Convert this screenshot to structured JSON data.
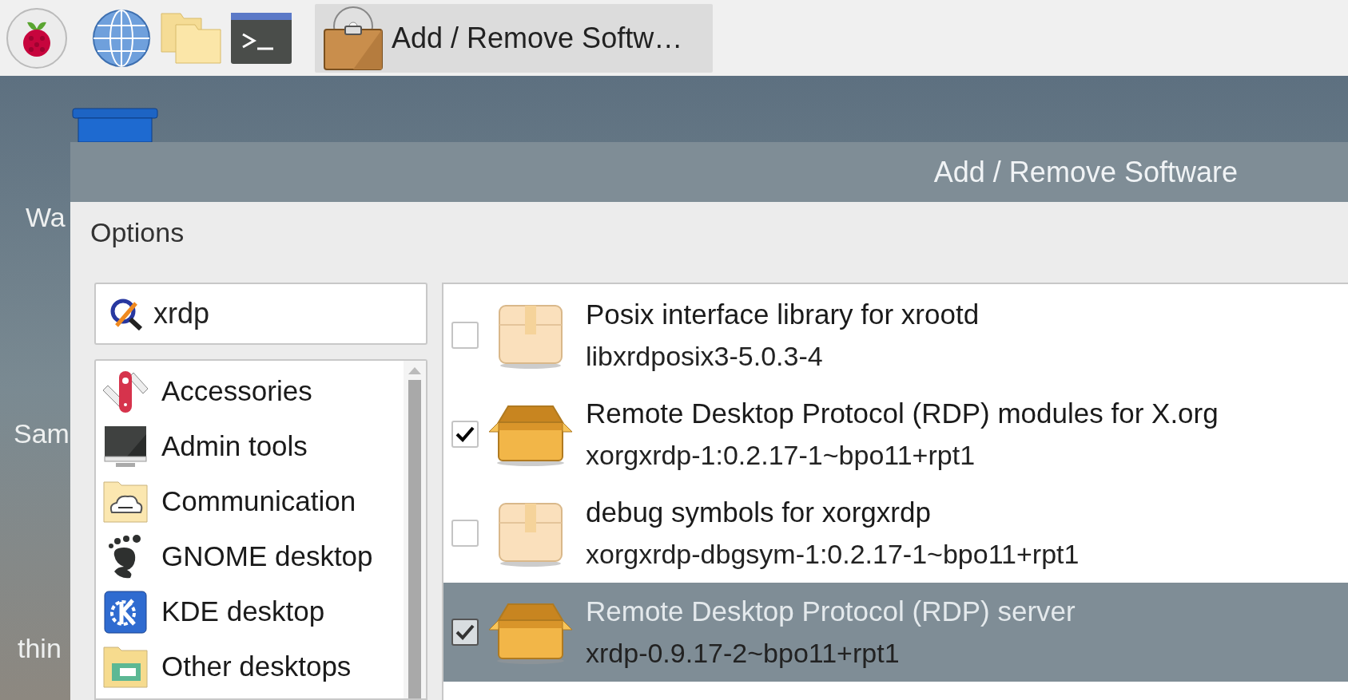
{
  "taskbar": {
    "task": {
      "label": "Add / Remove Softw…",
      "selected": true
    }
  },
  "desktop_icons": [
    {
      "label": "Wa"
    },
    {
      "label": "Sam"
    },
    {
      "label": "thin"
    }
  ],
  "window": {
    "title": "Add / Remove Software"
  },
  "menu": [
    "Options"
  ],
  "search": {
    "value": "xrdp"
  },
  "categories": [
    {
      "label": "Accessories",
      "selected": false
    },
    {
      "label": "Admin tools",
      "selected": false
    },
    {
      "label": "Communication",
      "selected": false
    },
    {
      "label": "GNOME desktop",
      "selected": false
    },
    {
      "label": "KDE desktop",
      "selected": false
    },
    {
      "label": "Other desktops",
      "selected": false
    }
  ],
  "packages": [
    {
      "name": "Posix interface library for xrootd",
      "version": "libxrdposix3-5.0.3-4",
      "checked": false,
      "selected": false
    },
    {
      "name": "Remote Desktop Protocol (RDP) modules for X.org",
      "version": "xorgxrdp-1:0.2.17-1~bpo11+rpt1",
      "checked": true,
      "selected": false
    },
    {
      "name": "debug symbols for xorgxrdp",
      "version": "xorgxrdp-dbgsym-1:0.2.17-1~bpo11+rpt1",
      "checked": false,
      "selected": false
    },
    {
      "name": "Remote Desktop Protocol (RDP) server",
      "version": "xrdp-0.9.17-2~bpo11+rpt1",
      "checked": true,
      "selected": true
    }
  ]
}
